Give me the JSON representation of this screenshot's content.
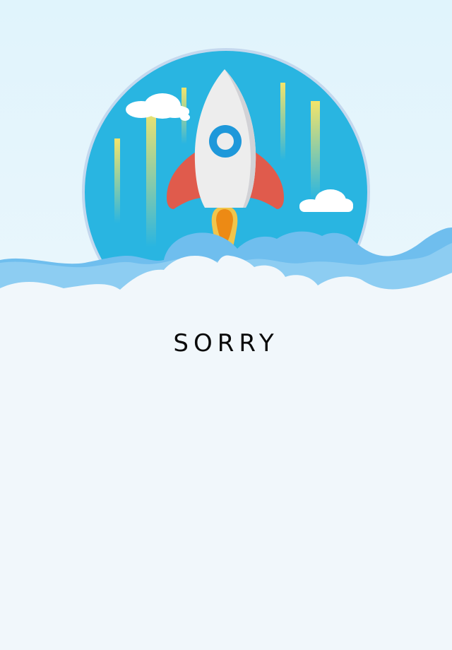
{
  "message": {
    "title": "SORRY"
  },
  "illustration": {
    "name": "rocket-launch-illustration",
    "elements": [
      "rocket-icon",
      "cloud-icon",
      "speed-line"
    ]
  },
  "colors": {
    "background_top": "#e0f4fc",
    "background_bottom": "#f1f7fb",
    "circle_fill": "#29b5e1",
    "circle_border": "#c4d8ee",
    "wave_front": "#8dcdf2",
    "wave_back": "#6fbeee",
    "rocket_body": "#ededed",
    "rocket_fin": "#e05b4c",
    "rocket_window": "#1e98da",
    "flame_outer": "#f1c54b",
    "flame_inner": "#ed8a14",
    "speed_line": "#f4e46a"
  }
}
